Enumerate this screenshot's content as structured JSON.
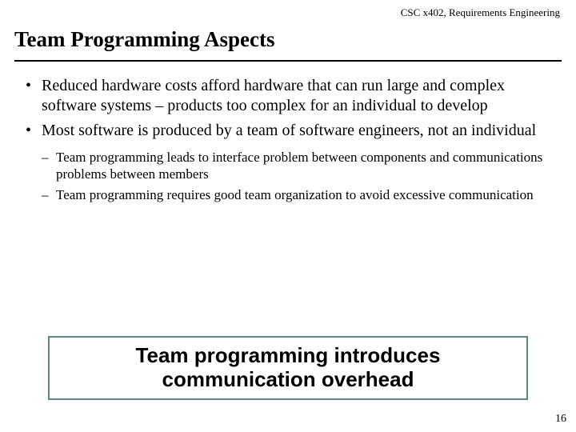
{
  "course_header": "CSC x402, Requirements Engineering",
  "title": "Team Programming Aspects",
  "bullets": [
    "Reduced hardware costs afford hardware that can run large and complex software systems – products too complex for an individual to develop",
    "Most software is produced by a team of software engineers, not an individual"
  ],
  "sub_bullets": [
    "Team programming leads to interface problem between components and communications problems between members",
    "Team programming requires good team organization to avoid excessive communication"
  ],
  "highlight": "Team programming introduces communication overhead",
  "page_number": "16"
}
